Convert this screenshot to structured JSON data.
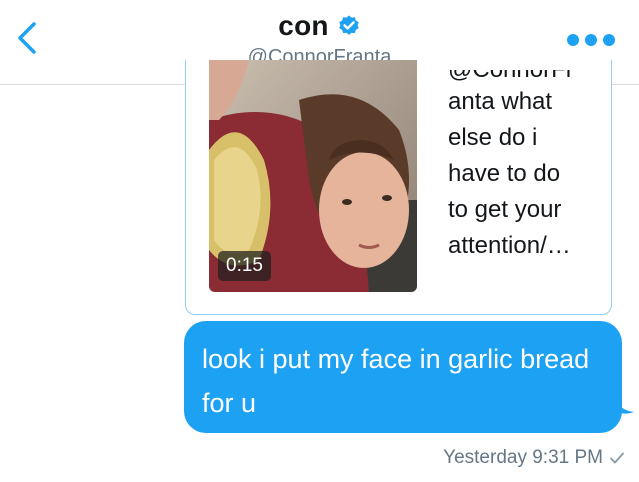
{
  "header": {
    "name": "con",
    "handle": "@ConnorFranta",
    "back_icon": "chevron-left-icon",
    "verified_icon": "verified-badge-icon",
    "more_icon": "more-dots-icon"
  },
  "shared_tweet": {
    "video_duration": "0:15",
    "text_cut": "@ConnorFr",
    "text_lines": [
      "anta what",
      "else do i",
      "have to do",
      "to get your",
      "attention/…"
    ]
  },
  "message": {
    "text": "look i put my face in garlic bread for u",
    "timestamp": "Yesterday 9:31 PM",
    "status_icon": "read-check-icon"
  },
  "colors": {
    "accent": "#1da1f2",
    "secondary_text": "#657786",
    "card_border": "#8fcef6"
  }
}
